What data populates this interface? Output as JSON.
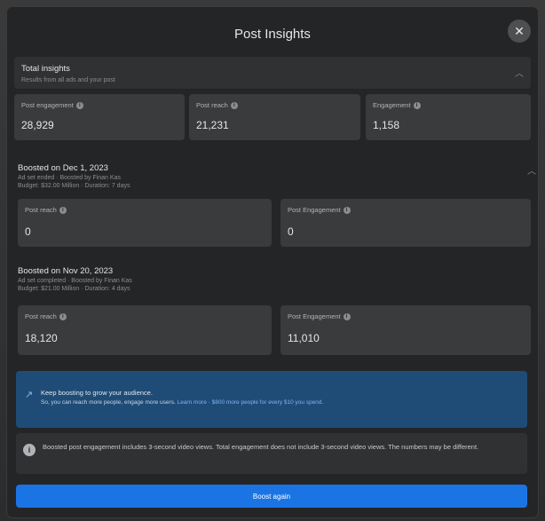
{
  "modal": {
    "title": "Post Insights",
    "close_icon": "close-icon"
  },
  "total": {
    "heading": "Total insights",
    "subtitle": "Results from all ads and your post",
    "cards": [
      {
        "label": "Post engagement",
        "value": "28,929"
      },
      {
        "label": "Post reach",
        "value": "21,231"
      },
      {
        "label": "Engagement",
        "value": "1,158"
      }
    ]
  },
  "boost1": {
    "heading": "Boosted on Dec 1, 2023",
    "meta_line1": "Ad set ended · Boosted by Finan Kas",
    "meta_line2": "Budget: $32.00 Million · Duration: 7 days",
    "cards": [
      {
        "label": "Post reach",
        "value": "0"
      },
      {
        "label": "Post Engagement",
        "value": "0"
      }
    ]
  },
  "boost2": {
    "heading": "Boosted on Nov 20, 2023",
    "meta_line1": "Ad set completed · Boosted by Finan Kas",
    "meta_line2": "Budget: $21.00 Million · Duration: 4 days",
    "cards": [
      {
        "label": "Post reach",
        "value": "18,120"
      },
      {
        "label": "Post Engagement",
        "value": "11,010"
      }
    ]
  },
  "promo": {
    "title": "Keep boosting to grow your audience.",
    "text": "So, you can reach more people, engage more users. Learn more · $800 more people for every $10 you spend.",
    "text_main": "So, you can reach more people, engage more users.",
    "text_link": "Learn more · $800 more people for every $10 you spend."
  },
  "note": {
    "text": "Boosted post engagement includes 3-second video views. Total engagement does not include 3-second video views. The numbers may be different."
  },
  "actions": {
    "boost_again": "Boost again"
  }
}
